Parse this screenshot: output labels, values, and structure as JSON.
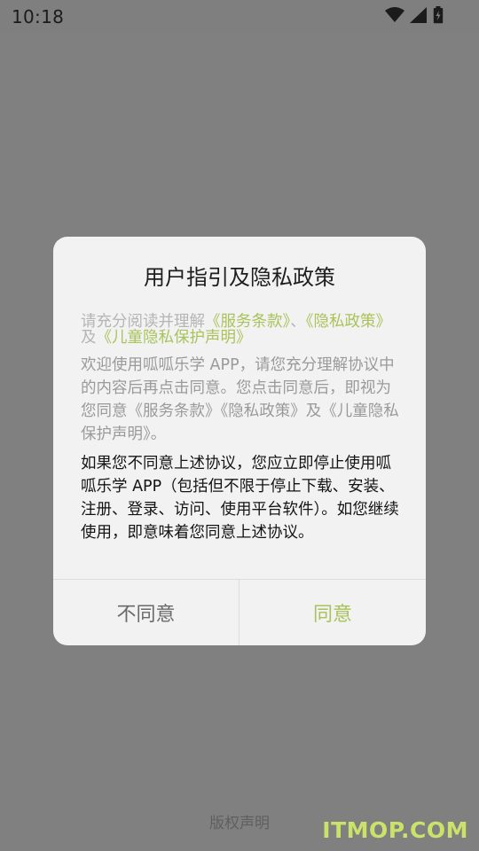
{
  "status_bar": {
    "time": "10:18",
    "icons": [
      "wifi-icon",
      "signal-icon",
      "battery-icon"
    ]
  },
  "dialog": {
    "title": "用户指引及隐私政策",
    "intro": {
      "prefix": "请充分阅读并理解",
      "link1": "《服务条款》",
      "sep1": "、",
      "link2": "《隐私政策》",
      "sep2": "及",
      "link3": "《儿童隐私保护声明》"
    },
    "gray_paragraph": "欢迎使用呱呱乐学 APP，请您充分理解协议中的内容后再点击同意。您点击同意后，即视为您同意《服务条款》《隐私政策》及《儿童隐私保护声明》。",
    "black_paragraph": "如果您不同意上述协议，您应立即停止使用呱呱乐学 APP（包括但不限于停止下载、安装、注册、登录、访问、使用平台软件）。如您继续使用，即意味着您同意上述协议。",
    "disagree_label": "不同意",
    "agree_label": "同意"
  },
  "footer": {
    "copyright": "版权声明",
    "watermark": "ITMOP.COM"
  },
  "colors": {
    "accent": "#a8c35a",
    "overlay": "#808080",
    "dialog_bg": "#f2f2f2"
  }
}
